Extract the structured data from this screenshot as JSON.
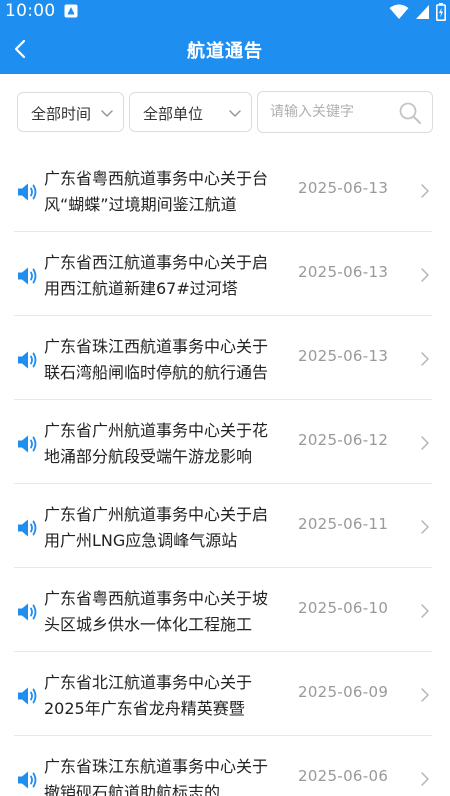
{
  "statusbar": {
    "time": "10:00"
  },
  "header": {
    "title": "航道通告"
  },
  "filters": {
    "time_label": "全部时间",
    "unit_label": "全部单位",
    "search_placeholder": "请输入关键字",
    "search_value": ""
  },
  "notices": [
    {
      "title": "广东省粤西航道事务中心关于台风“蝴蝶”过境期间鉴江航道",
      "date": "2025-06-13"
    },
    {
      "title": "广东省西江航道事务中心关于启用西江航道新建67#过河塔",
      "date": "2025-06-13"
    },
    {
      "title": "广东省珠江西航道事务中心关于联石湾船闸临时停航的航行通告",
      "date": "2025-06-13"
    },
    {
      "title": "广东省广州航道事务中心关于花地涌部分航段受端午游龙影响",
      "date": "2025-06-12"
    },
    {
      "title": "广东省广州航道事务中心关于启用广州LNG应急调峰气源站",
      "date": "2025-06-11"
    },
    {
      "title": "广东省粤西航道事务中心关于坡头区城乡供水一体化工程施工",
      "date": "2025-06-10"
    },
    {
      "title": "广东省北江航道事务中心关于2025年广东省龙舟精英赛暨",
      "date": "2025-06-09"
    },
    {
      "title": "广东省珠江东航道事务中心关于撤销砚石航道助航标志的",
      "date": "2025-06-06"
    }
  ],
  "colors": {
    "primary": "#1f8ef1",
    "accent": "#1f8ef1",
    "text": "#222222",
    "muted": "#999999"
  },
  "icons": {
    "status": [
      "notification-icon",
      "wifi-icon",
      "signal-icon",
      "battery-icon"
    ],
    "back": "back-arrow-icon",
    "dropdown": "chevron-down-icon",
    "search": "search-icon",
    "row_lead": "speaker-icon",
    "row_trail": "chevron-right-icon"
  }
}
